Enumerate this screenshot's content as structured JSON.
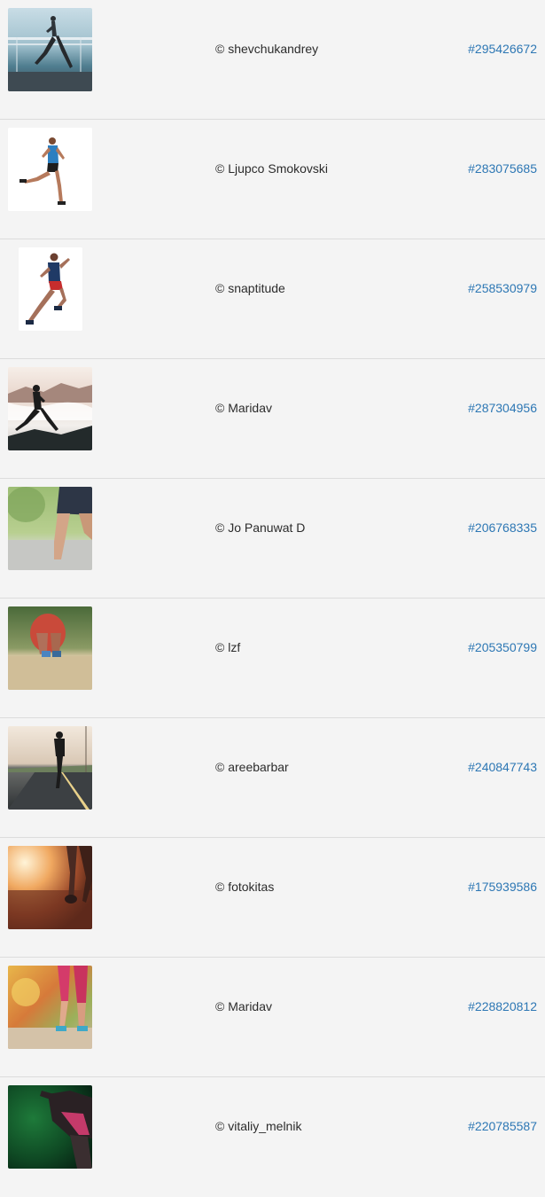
{
  "items": [
    {
      "credit": "© shevchukandrey",
      "id": "#295426672",
      "image_icon": "runner-on-bridge-photo"
    },
    {
      "credit": "© Ljupco Smokovski",
      "id": "#283075685",
      "image_icon": "runner-white-background-photo"
    },
    {
      "credit": "© snaptitude",
      "id": "#258530979",
      "image_icon": "sprinter-white-background-photo"
    },
    {
      "credit": "© Maridav",
      "id": "#287304956",
      "image_icon": "runner-silhouette-mountains-photo"
    },
    {
      "credit": "© Jo Panuwat D",
      "id": "#206768335",
      "image_icon": "runner-legs-park-photo"
    },
    {
      "credit": "© lzf",
      "id": "#205350799",
      "image_icon": "runner-shoes-road-photo"
    },
    {
      "credit": "© areebarbar",
      "id": "#240847743",
      "image_icon": "runner-on-road-photo"
    },
    {
      "credit": "© fotokitas",
      "id": "#175939586",
      "image_icon": "runner-legs-sunset-photo"
    },
    {
      "credit": "© Maridav",
      "id": "#228820812",
      "image_icon": "runner-autumn-photo"
    },
    {
      "credit": "© vitaliy_melnik",
      "id": "#220785587",
      "image_icon": "athlete-dark-green-photo"
    }
  ]
}
